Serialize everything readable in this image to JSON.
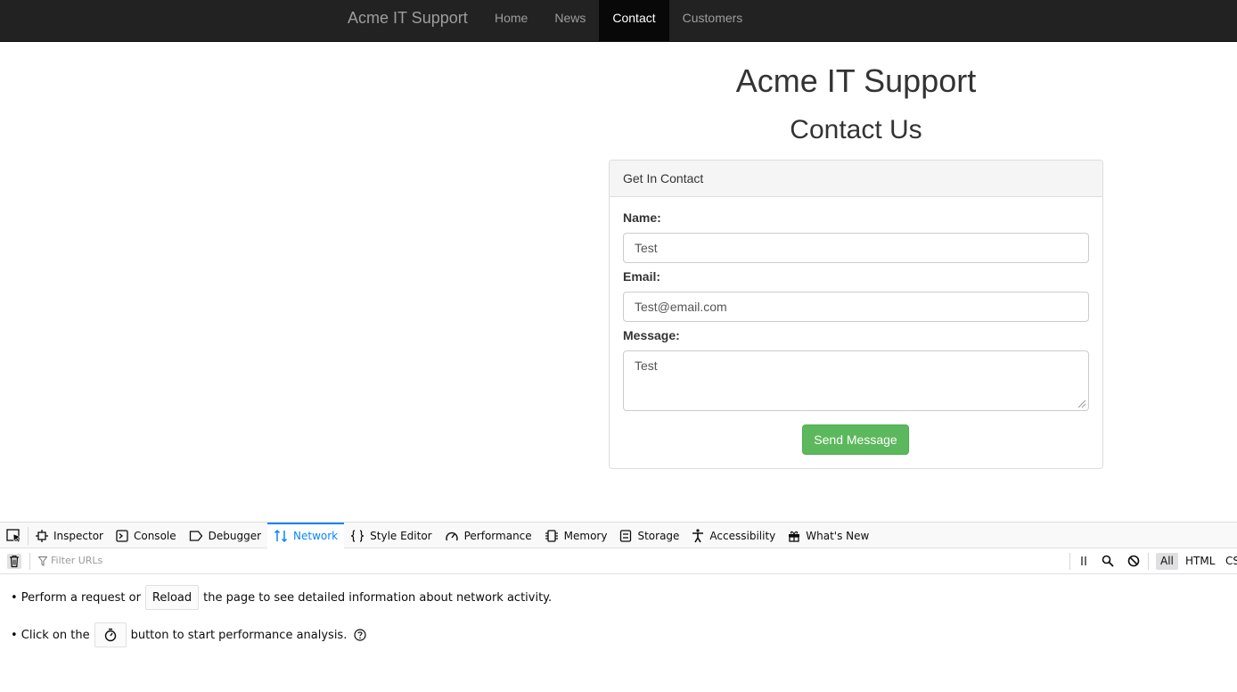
{
  "navbar": {
    "brand": "Acme IT Support",
    "links": [
      {
        "label": "Home",
        "active": false
      },
      {
        "label": "News",
        "active": false
      },
      {
        "label": "Contact",
        "active": true
      },
      {
        "label": "Customers",
        "active": false
      }
    ]
  },
  "page": {
    "title": "Acme IT Support",
    "subtitle": "Contact Us"
  },
  "contact_form": {
    "heading": "Get In Contact",
    "name_label": "Name:",
    "name_value": "Test",
    "email_label": "Email:",
    "email_value": "Test@email.com",
    "message_label": "Message:",
    "message_value": "Test",
    "submit_label": "Send Message"
  },
  "devtools": {
    "tabs": [
      {
        "label": "Inspector",
        "icon": "inspector-icon",
        "active": false
      },
      {
        "label": "Console",
        "icon": "console-icon",
        "active": false
      },
      {
        "label": "Debugger",
        "icon": "debugger-icon",
        "active": false
      },
      {
        "label": "Network",
        "icon": "network-icon",
        "active": true
      },
      {
        "label": "Style Editor",
        "icon": "style-editor-icon",
        "active": false
      },
      {
        "label": "Performance",
        "icon": "performance-icon",
        "active": false
      },
      {
        "label": "Memory",
        "icon": "memory-icon",
        "active": false
      },
      {
        "label": "Storage",
        "icon": "storage-icon",
        "active": false
      },
      {
        "label": "Accessibility",
        "icon": "accessibility-icon",
        "active": false
      },
      {
        "label": "What's New",
        "icon": "whats-new-icon",
        "active": false
      }
    ],
    "filter_placeholder": "Filter URLs",
    "type_filters": [
      "All",
      "HTML",
      "CSS"
    ],
    "message_1": {
      "prefix": "• Perform a request or",
      "button": "Reload",
      "suffix": "the page to see detailed information about network activity."
    },
    "message_2": {
      "prefix": "• Click on the",
      "suffix": "button to start performance analysis."
    }
  },
  "colors": {
    "navbar_bg": "#222222",
    "nav_active_bg": "#080808",
    "send_button": "#5cb85c",
    "devtools_accent": "#0a84ff"
  }
}
